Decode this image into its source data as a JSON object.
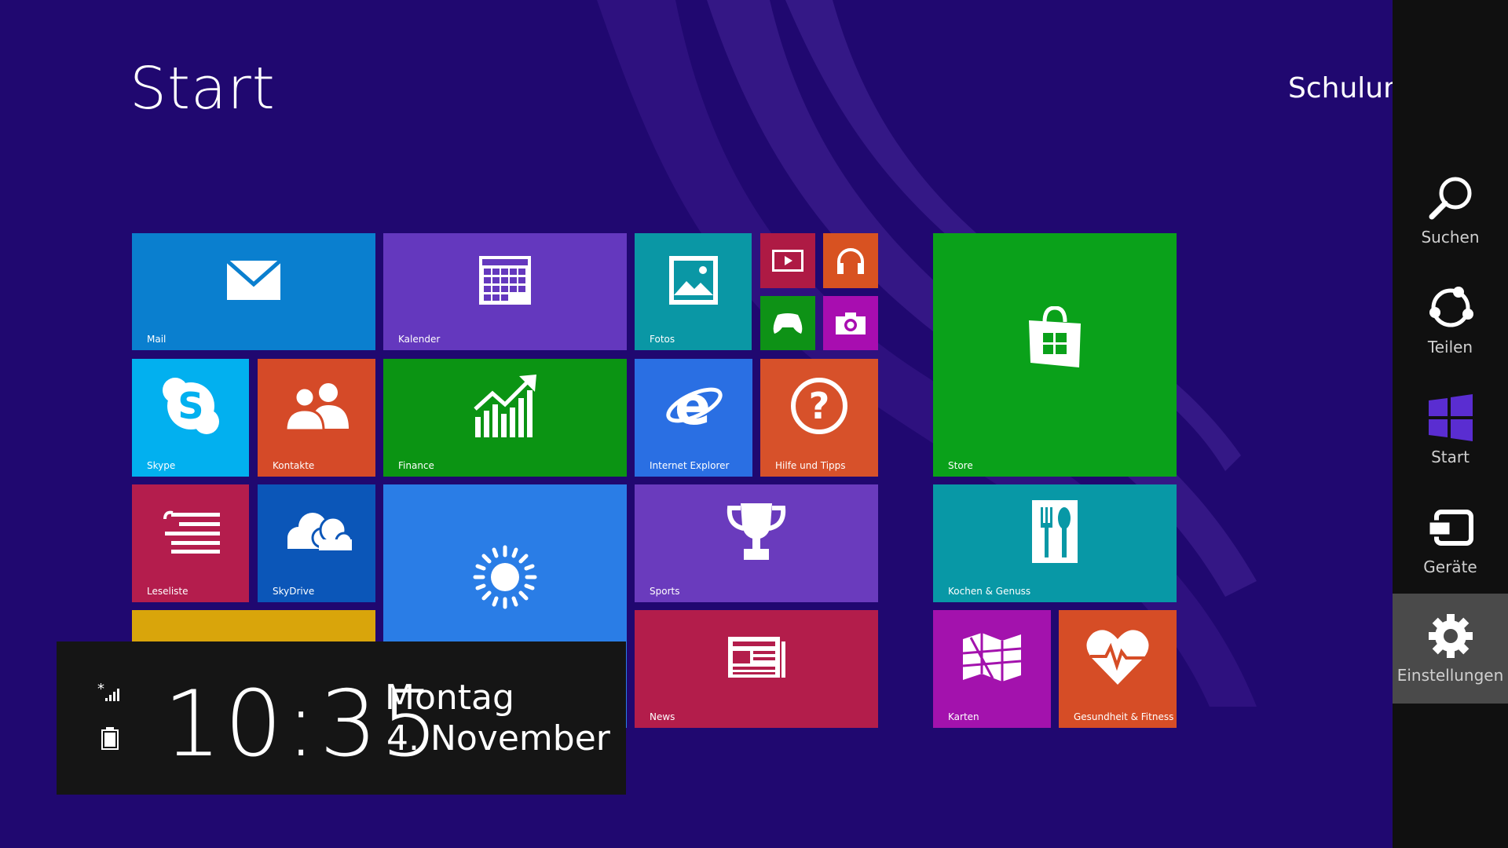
{
  "screen": {
    "title": "Start",
    "user": "Schulung"
  },
  "tiles": [
    {
      "label": "Mail",
      "icon": "mail-icon",
      "color": "#0a7fcf"
    },
    {
      "label": "Kalender",
      "icon": "calendar-icon",
      "color": "#6438be"
    },
    {
      "label": "Fotos",
      "icon": "photos-icon",
      "color": "#0a97a5"
    },
    {
      "label": "",
      "icon": "video-icon",
      "color": "#ae1a44"
    },
    {
      "label": "",
      "icon": "headphones-icon",
      "color": "#d85221"
    },
    {
      "label": "",
      "icon": "gamepad-icon",
      "color": "#0e9216"
    },
    {
      "label": "",
      "icon": "camera-icon",
      "color": "#a80db0"
    },
    {
      "label": "Store",
      "icon": "store-icon",
      "color": "#0aa11a"
    },
    {
      "label": "Skype",
      "icon": "skype-icon",
      "color": "#02b0ef"
    },
    {
      "label": "Kontakte",
      "icon": "people-icon",
      "color": "#d54a28"
    },
    {
      "label": "Finance",
      "icon": "finance-chart-icon",
      "color": "#0b9413"
    },
    {
      "label": "Internet Explorer",
      "icon": "internet-explorer-icon",
      "color": "#2a6fe3"
    },
    {
      "label": "Hilfe und Tipps",
      "icon": "help-icon",
      "color": "#d7512a"
    },
    {
      "label": "Leseliste",
      "icon": "reading-list-icon",
      "color": "#b41d4d"
    },
    {
      "label": "SkyDrive",
      "icon": "cloud-icon",
      "color": "#0b56b8"
    },
    {
      "label": "",
      "icon": "sun-icon",
      "color": "#2a7de6"
    },
    {
      "label": "Sports",
      "icon": "trophy-icon",
      "color": "#6a3bbd"
    },
    {
      "label": "Kochen & Genuss",
      "icon": "cutlery-icon",
      "color": "#0898a6"
    },
    {
      "label": "",
      "icon": "",
      "color": "#d9a50b"
    },
    {
      "label": "News",
      "icon": "news-icon",
      "color": "#b31d4b"
    },
    {
      "label": "Karten",
      "icon": "map-icon",
      "color": "#a312ad"
    },
    {
      "label": "Gesundheit & Fitness",
      "icon": "heart-pulse-icon",
      "color": "#d64d26"
    }
  ],
  "charms": [
    {
      "label": "Suchen",
      "icon": "search-icon"
    },
    {
      "label": "Teilen",
      "icon": "share-icon"
    },
    {
      "label": "Start",
      "icon": "windows-logo-icon"
    },
    {
      "label": "Geräte",
      "icon": "devices-icon"
    },
    {
      "label": "Einstellungen",
      "icon": "gear-icon",
      "selected": true
    }
  ],
  "clock": {
    "time": "10:35",
    "day": "Montag",
    "date": "4. November"
  },
  "colors": {
    "background": "#200870",
    "charm_bar": "#101010",
    "charm_selected": "#4a4a4a",
    "clock_panel": "#151515"
  }
}
